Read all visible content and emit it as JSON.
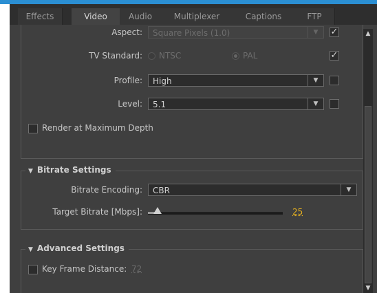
{
  "tabs": [
    {
      "label": "Effects"
    },
    {
      "label": "Video"
    },
    {
      "label": "Audio"
    },
    {
      "label": "Multiplexer"
    },
    {
      "label": "Captions"
    },
    {
      "label": "FTP"
    }
  ],
  "active_tab": "Video",
  "video": {
    "aspect": {
      "label": "Aspect:",
      "value": "Square Pixels (1.0)",
      "checked": true
    },
    "tv_standard": {
      "label": "TV Standard:",
      "options": [
        "NTSC",
        "PAL"
      ],
      "selected": "PAL",
      "checked": true
    },
    "profile": {
      "label": "Profile:",
      "value": "High",
      "checked": false
    },
    "level": {
      "label": "Level:",
      "value": "5.1",
      "checked": false
    },
    "render_max_depth": {
      "label": "Render at Maximum Depth",
      "checked": false
    }
  },
  "bitrate": {
    "title": "Bitrate Settings",
    "encoding": {
      "label": "Bitrate Encoding:",
      "value": "CBR"
    },
    "target": {
      "label": "Target Bitrate [Mbps]:",
      "value": "25",
      "fraction": 0.07
    }
  },
  "advanced": {
    "title": "Advanced Settings",
    "key_frame": {
      "label": "Key Frame Distance:",
      "value": "72",
      "checked": false
    }
  },
  "colors": {
    "accent": "#2b8fd3",
    "value_highlight": "#e5b020"
  }
}
